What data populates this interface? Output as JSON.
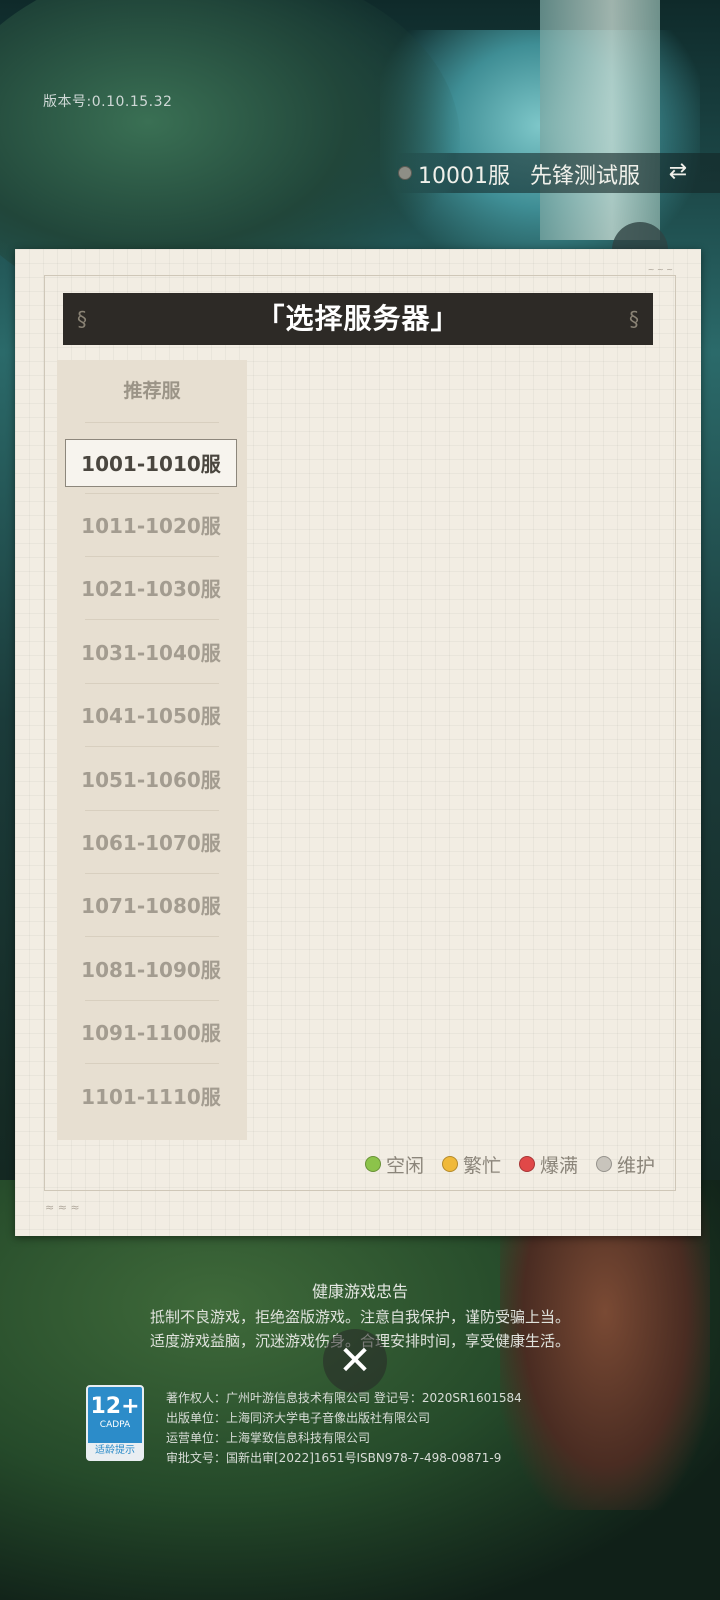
{
  "version": {
    "label": "版本号:0.10.15.32"
  },
  "current_server": {
    "id": "10001服",
    "name": "先锋测试服",
    "status_color": "#8e8e86"
  },
  "panel": {
    "title": "「选择服务器」",
    "recommended": "推荐服",
    "ranges": [
      "1001-1010服",
      "1011-1020服",
      "1021-1030服",
      "1031-1040服",
      "1041-1050服",
      "1051-1060服",
      "1061-1070服",
      "1071-1080服",
      "1081-1090服",
      "1091-1100服",
      "1101-1110服"
    ],
    "selected_index": 0
  },
  "legend": [
    {
      "label": "空闲",
      "color": "#8cc34a"
    },
    {
      "label": "繁忙",
      "color": "#f0b93a"
    },
    {
      "label": "爆满",
      "color": "#e04848"
    },
    {
      "label": "维护",
      "color": "#c8c4bc"
    }
  ],
  "notice": {
    "title": "健康游戏忠告",
    "line1": "抵制不良游戏，拒绝盗版游戏。注意自我保护，谨防受骗上当。",
    "line2": "适度游戏益脑，沉迷游戏伤身。合理安排时间，享受健康生活。"
  },
  "age_rating": {
    "value": "12+",
    "org": "CADPA",
    "tip": "适龄提示"
  },
  "credits": [
    "著作权人：广州叶游信息技术有限公司    登记号：2020SR1601584",
    "出版单位：上海同济大学电子音像出版社有限公司",
    "运营单位：上海掌致信息科技有限公司",
    "审批文号：国新出审[2022]1651号ISBN978-7-498-09871-9"
  ]
}
